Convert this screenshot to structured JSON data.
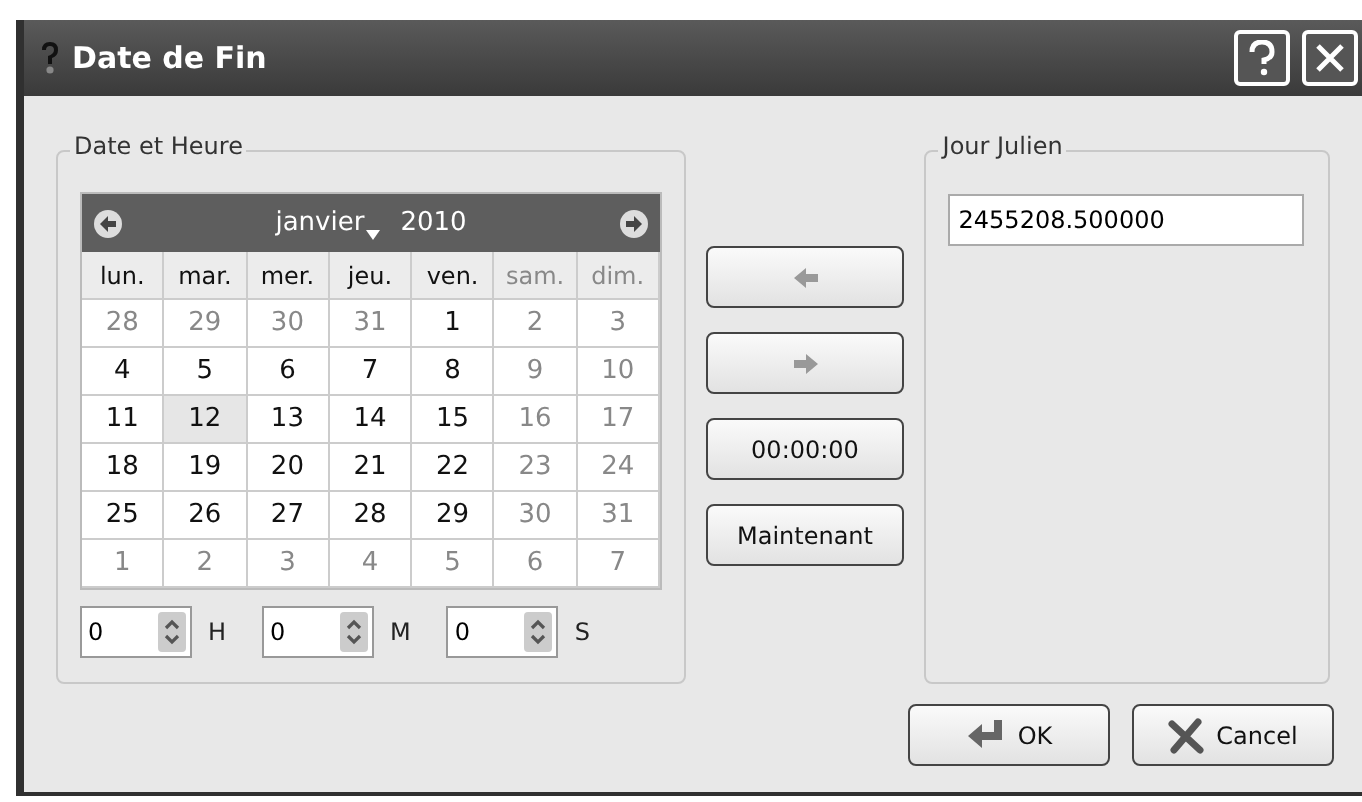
{
  "window": {
    "title": "Date de Fin"
  },
  "date_group": {
    "label": "Date et Heure",
    "calendar": {
      "month": "janvier",
      "year": "2010",
      "weekdays": [
        {
          "label": "lun.",
          "muted": false
        },
        {
          "label": "mar.",
          "muted": false
        },
        {
          "label": "mer.",
          "muted": false
        },
        {
          "label": "jeu.",
          "muted": false
        },
        {
          "label": "ven.",
          "muted": false
        },
        {
          "label": "sam.",
          "muted": true
        },
        {
          "label": "dim.",
          "muted": true
        }
      ],
      "weeks": [
        [
          {
            "day": "28",
            "muted": true,
            "selected": false
          },
          {
            "day": "29",
            "muted": true,
            "selected": false
          },
          {
            "day": "30",
            "muted": true,
            "selected": false
          },
          {
            "day": "31",
            "muted": true,
            "selected": false
          },
          {
            "day": "1",
            "muted": false,
            "selected": false
          },
          {
            "day": "2",
            "muted": true,
            "selected": false
          },
          {
            "day": "3",
            "muted": true,
            "selected": false
          }
        ],
        [
          {
            "day": "4",
            "muted": false,
            "selected": false
          },
          {
            "day": "5",
            "muted": false,
            "selected": false
          },
          {
            "day": "6",
            "muted": false,
            "selected": false
          },
          {
            "day": "7",
            "muted": false,
            "selected": false
          },
          {
            "day": "8",
            "muted": false,
            "selected": false
          },
          {
            "day": "9",
            "muted": true,
            "selected": false
          },
          {
            "day": "10",
            "muted": true,
            "selected": false
          }
        ],
        [
          {
            "day": "11",
            "muted": false,
            "selected": false
          },
          {
            "day": "12",
            "muted": false,
            "selected": true
          },
          {
            "day": "13",
            "muted": false,
            "selected": false
          },
          {
            "day": "14",
            "muted": false,
            "selected": false
          },
          {
            "day": "15",
            "muted": false,
            "selected": false
          },
          {
            "day": "16",
            "muted": true,
            "selected": false
          },
          {
            "day": "17",
            "muted": true,
            "selected": false
          }
        ],
        [
          {
            "day": "18",
            "muted": false,
            "selected": false
          },
          {
            "day": "19",
            "muted": false,
            "selected": false
          },
          {
            "day": "20",
            "muted": false,
            "selected": false
          },
          {
            "day": "21",
            "muted": false,
            "selected": false
          },
          {
            "day": "22",
            "muted": false,
            "selected": false
          },
          {
            "day": "23",
            "muted": true,
            "selected": false
          },
          {
            "day": "24",
            "muted": true,
            "selected": false
          }
        ],
        [
          {
            "day": "25",
            "muted": false,
            "selected": false
          },
          {
            "day": "26",
            "muted": false,
            "selected": false
          },
          {
            "day": "27",
            "muted": false,
            "selected": false
          },
          {
            "day": "28",
            "muted": false,
            "selected": false
          },
          {
            "day": "29",
            "muted": false,
            "selected": false
          },
          {
            "day": "30",
            "muted": true,
            "selected": false
          },
          {
            "day": "31",
            "muted": true,
            "selected": false
          }
        ],
        [
          {
            "day": "1",
            "muted": true,
            "selected": false
          },
          {
            "day": "2",
            "muted": true,
            "selected": false
          },
          {
            "day": "3",
            "muted": true,
            "selected": false
          },
          {
            "day": "4",
            "muted": true,
            "selected": false
          },
          {
            "day": "5",
            "muted": true,
            "selected": false
          },
          {
            "day": "6",
            "muted": true,
            "selected": false
          },
          {
            "day": "7",
            "muted": true,
            "selected": false
          }
        ]
      ]
    },
    "spinners": [
      {
        "value": "0",
        "unit": "H"
      },
      {
        "value": "0",
        "unit": "M"
      },
      {
        "value": "0",
        "unit": "S"
      }
    ]
  },
  "middle_buttons": [
    {
      "kind": "left"
    },
    {
      "kind": "right"
    },
    {
      "kind": "text",
      "label": "00:00:00"
    },
    {
      "kind": "text",
      "label": "Maintenant"
    }
  ],
  "julian_group": {
    "label": "Jour Julien",
    "value": "2455208.500000"
  },
  "buttons": [
    {
      "kind": "ok",
      "label": "OK"
    },
    {
      "kind": "cancel",
      "label": "Cancel"
    }
  ]
}
